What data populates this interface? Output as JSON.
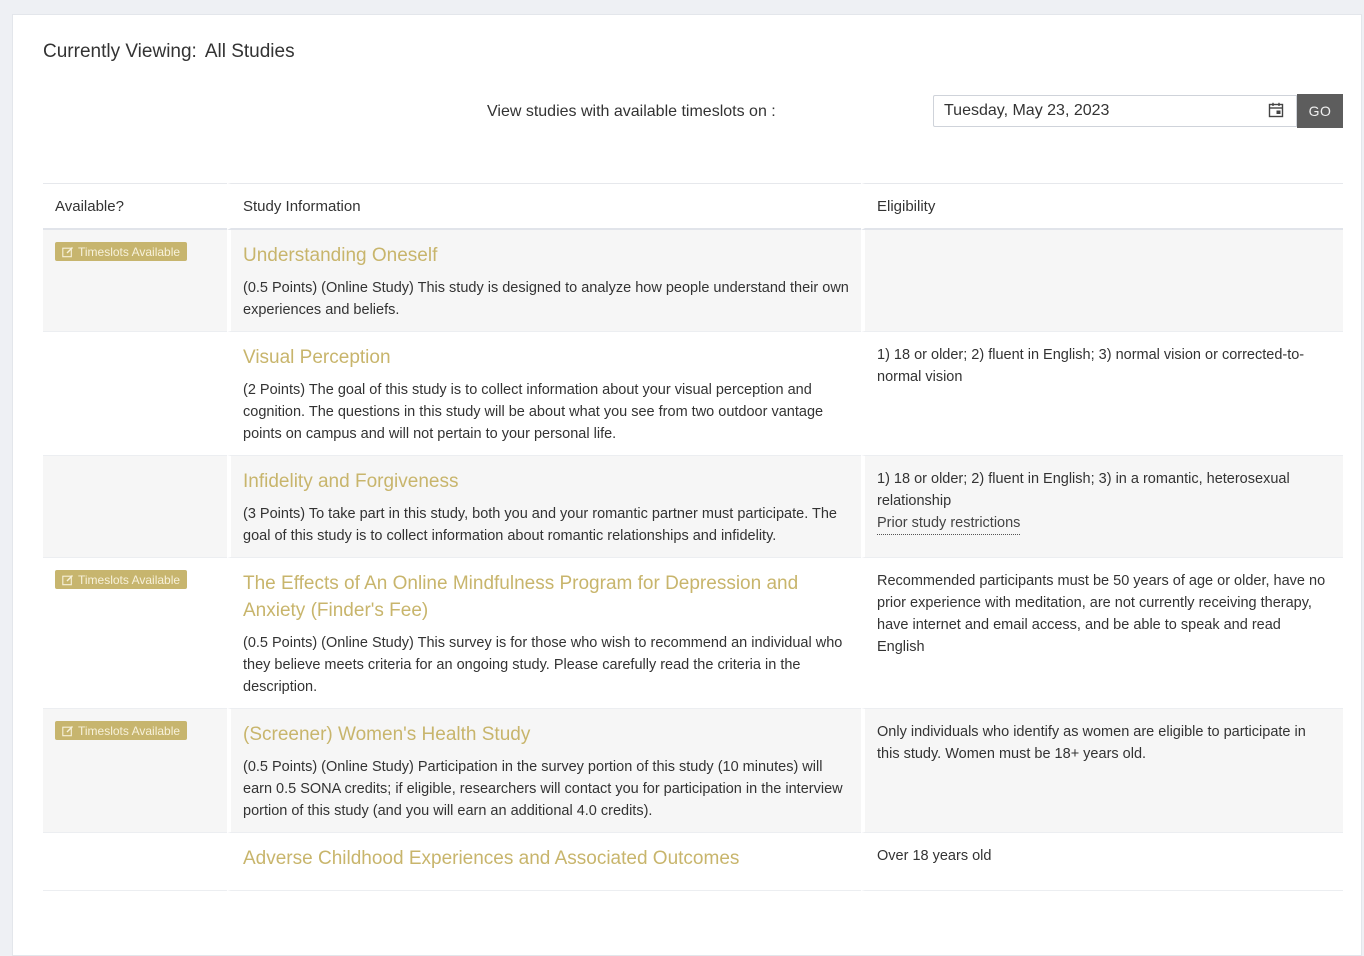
{
  "header": {
    "viewing_label": "Currently Viewing:",
    "viewing_value": "All Studies"
  },
  "filter": {
    "label": "View studies with available timeslots on :",
    "date_value": "Tuesday, May 23, 2023",
    "go_label": "GO"
  },
  "table": {
    "columns": [
      "Available?",
      "Study Information",
      "Eligibility"
    ],
    "badge_label": "Timeslots Available",
    "rows": [
      {
        "available": true,
        "title": "Understanding Oneself",
        "description": "(0.5 Points) (Online Study) This study is designed to analyze how people understand their own experiences and beliefs.",
        "eligibility": "",
        "restriction_link": ""
      },
      {
        "available": false,
        "title": "Visual Perception",
        "description": "(2 Points) The goal of this study is to collect information about your visual perception and cognition. The questions in this study will be about what you see from two outdoor vantage points on campus and will not pertain to your personal life.",
        "eligibility": "1) 18 or older; 2) fluent in English; 3) normal vision or corrected-to-normal vision",
        "restriction_link": ""
      },
      {
        "available": false,
        "title": "Infidelity and Forgiveness",
        "description": "(3 Points) To take part in this study, both you and your romantic partner must participate. The goal of this study is to collect information about romantic relationships and infidelity.",
        "eligibility": "1) 18 or older; 2) fluent in English; 3) in a romantic, heterosexual relationship",
        "restriction_link": "Prior study restrictions"
      },
      {
        "available": true,
        "title": "The Effects of An Online Mindfulness Program for Depression and Anxiety (Finder's Fee)",
        "description": "(0.5 Points) (Online Study) This survey is for those who wish to recommend an individual who they believe meets criteria for an ongoing study. Please carefully read the criteria in the description.",
        "eligibility": "Recommended participants must be 50 years of age or older, have no prior experience with meditation, are not currently receiving therapy, have internet and email access, and be able to speak and read English",
        "restriction_link": ""
      },
      {
        "available": true,
        "title": "(Screener) Women's Health Study",
        "description": "(0.5 Points) (Online Study) Participation in the survey portion of this study (10 minutes) will earn 0.5 SONA credits; if eligible, researchers will contact you for participation in the interview portion of this study (and you will earn an additional 4.0 credits).",
        "eligibility": "Only individuals who identify as women are eligible to participate in this study. Women must be 18+ years old.",
        "restriction_link": ""
      },
      {
        "available": false,
        "title": "Adverse Childhood Experiences and Associated Outcomes",
        "description": "",
        "eligibility": "Over 18 years old",
        "restriction_link": ""
      }
    ]
  },
  "colors": {
    "accent_gold": "#c8b56c",
    "badge_bg": "#c7b56e",
    "go_button": "#5d5d5d"
  }
}
